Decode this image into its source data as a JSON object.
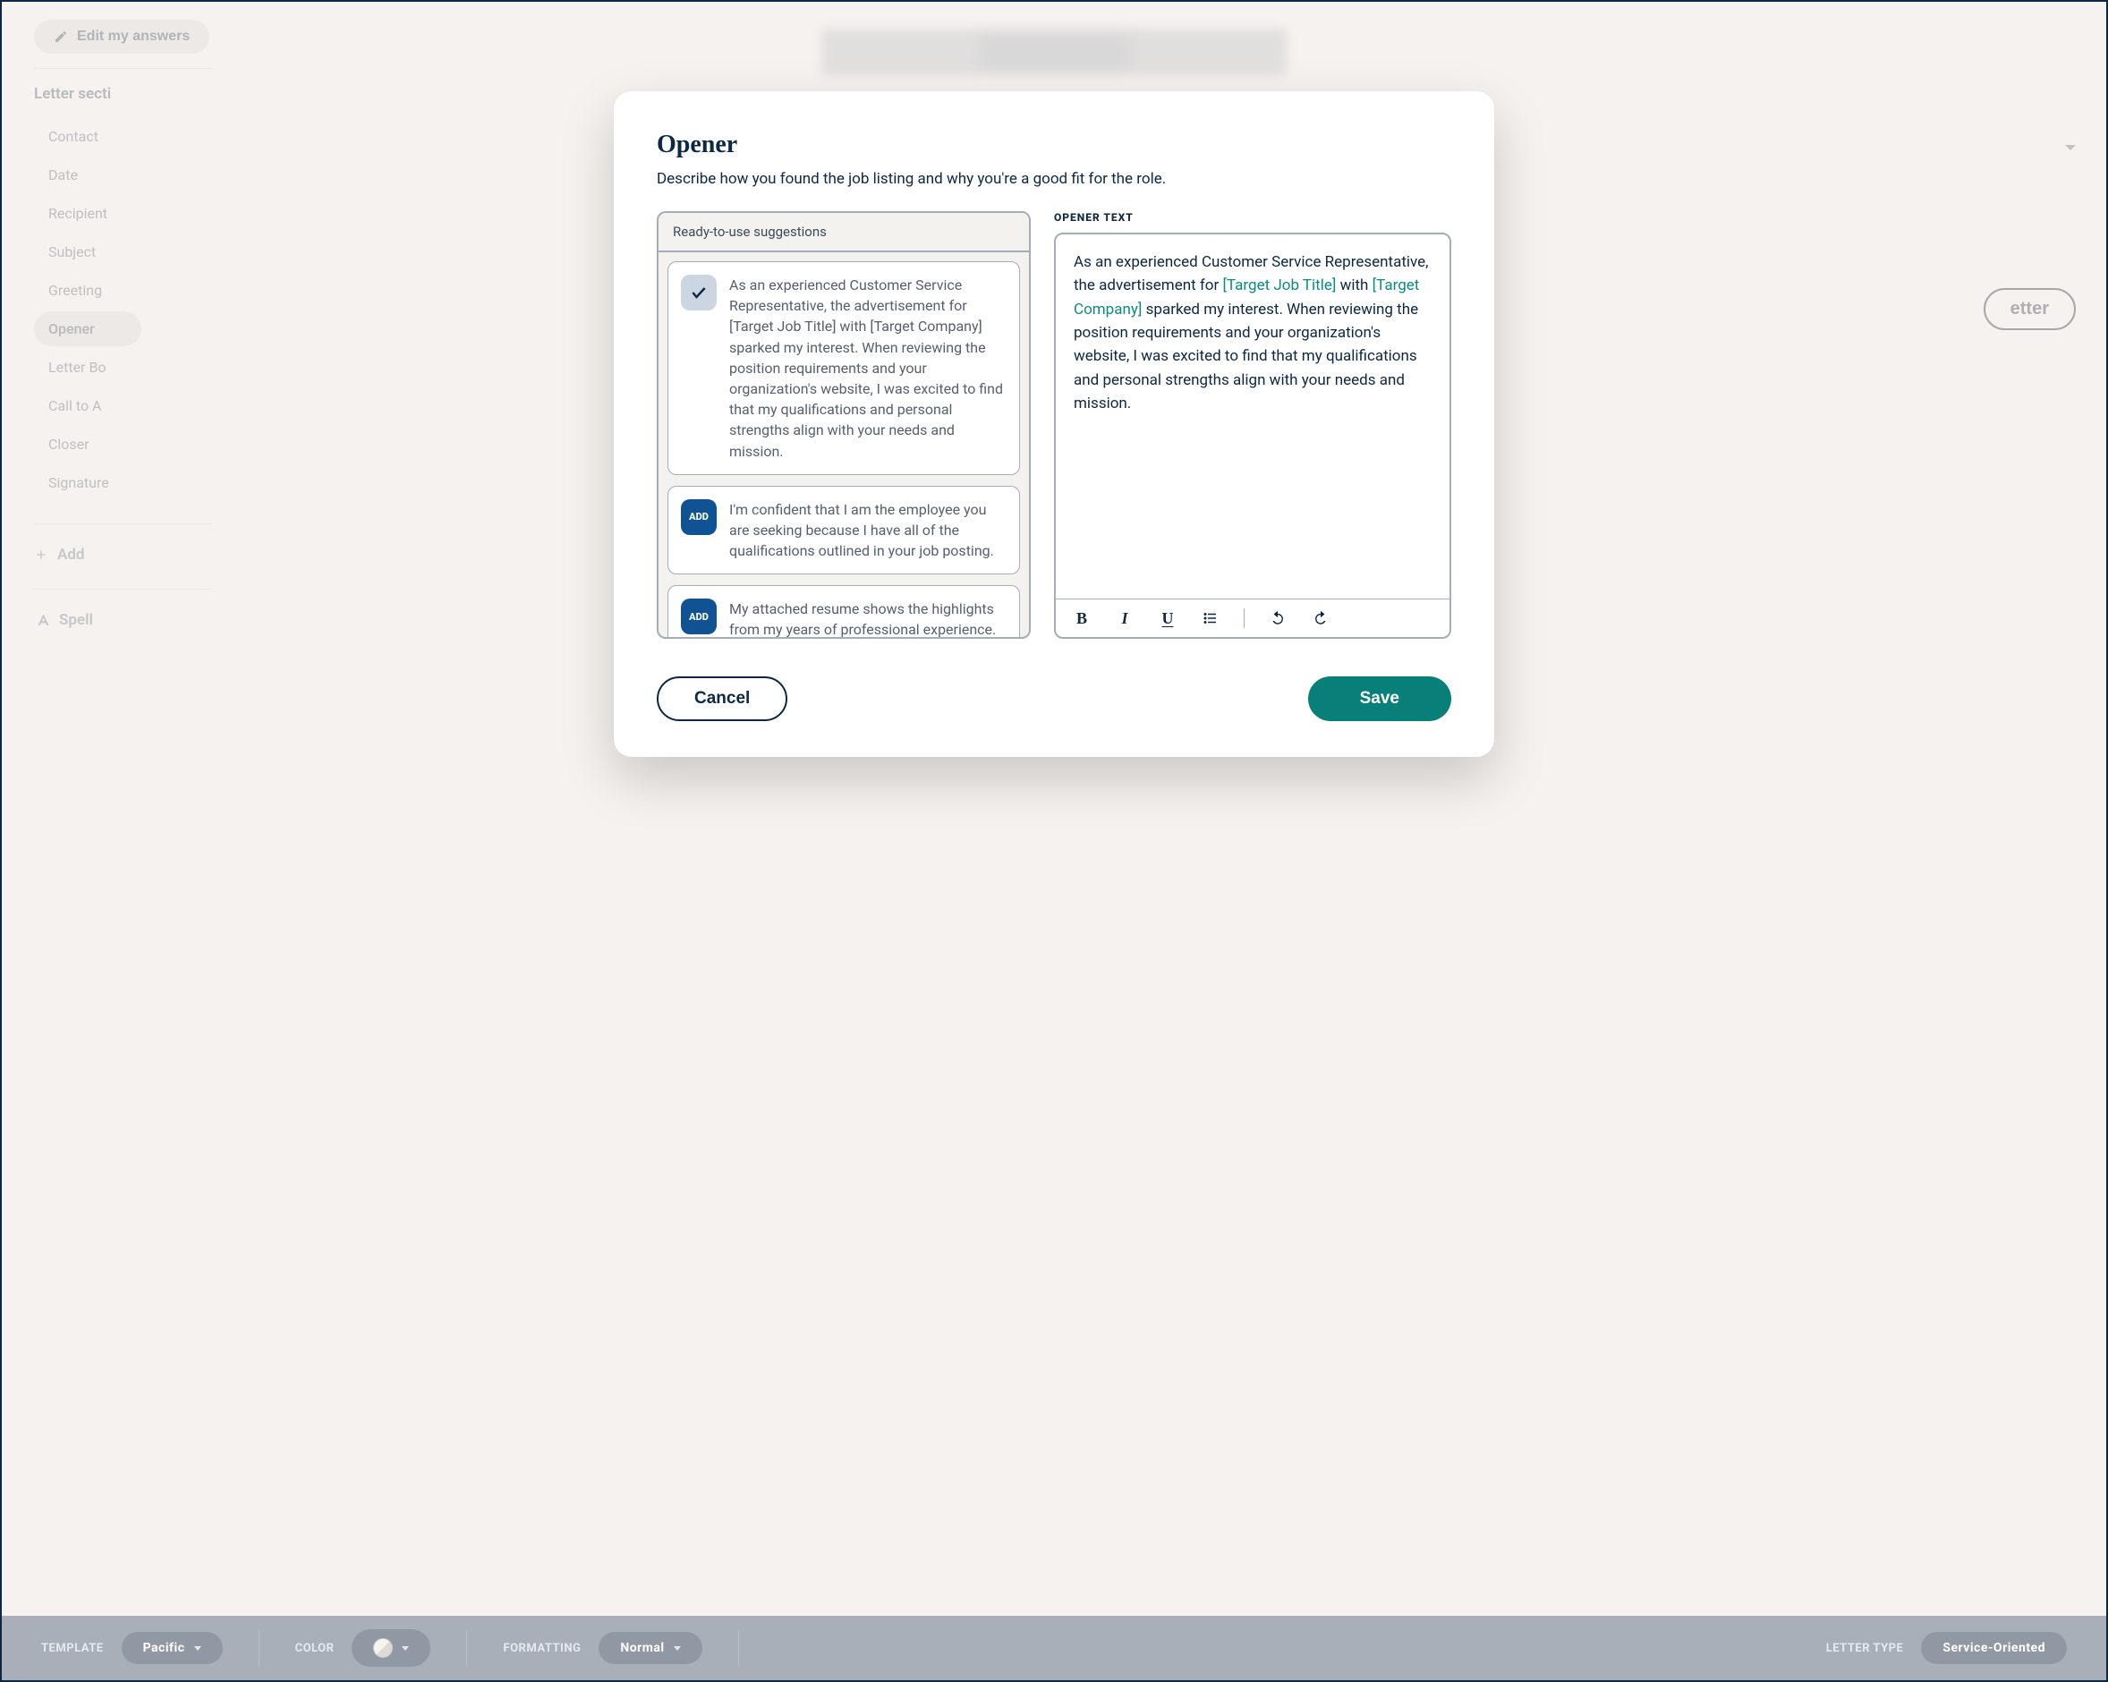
{
  "header": {
    "edit_answers": "Edit my answers"
  },
  "sidebar": {
    "title_truncated": "Letter secti",
    "items": [
      {
        "label": "Contact"
      },
      {
        "label": "Date"
      },
      {
        "label": "Recipient"
      },
      {
        "label": "Subject"
      },
      {
        "label": "Greeting"
      },
      {
        "label": "Opener",
        "active": true
      },
      {
        "label": "Letter Bo"
      },
      {
        "label": "Call to A"
      },
      {
        "label": "Closer"
      },
      {
        "label": "Signature"
      }
    ],
    "add_section_truncated": "Add",
    "spellcheck_truncated": "Spell"
  },
  "preview_button_truncated": "etter",
  "modal": {
    "title": "Opener",
    "subtitle": "Describe how you found the job listing and why you're a good fit for the role.",
    "suggestions_header": "Ready-to-use suggestions",
    "add_label": "ADD",
    "suggestions": [
      {
        "selected": true,
        "text": "As an experienced Customer Service Representative, the advertisement for [Target Job Title] with [Target Company] sparked my interest. When reviewing the position requirements and your organization's website, I was excited to find that my qualifications and personal strengths align with your needs and mission."
      },
      {
        "selected": false,
        "text": "I'm confident that I am the employee you are seeking because I have all of the qualifications outlined in your job posting."
      },
      {
        "selected": false,
        "text": "My attached resume shows the highlights from my years of professional experience."
      }
    ],
    "editor_label": "OPENER TEXT",
    "editor_text_parts": [
      {
        "t": "As an experienced Customer Service Representative, the advertisement for ",
        "ph": false
      },
      {
        "t": "[Target Job Title]",
        "ph": true
      },
      {
        "t": " with ",
        "ph": false
      },
      {
        "t": "[Target Company]",
        "ph": true
      },
      {
        "t": " sparked my interest. When reviewing the position requirements and your organization's website, I was excited to find that my qualifications and personal strengths align with your needs and mission.",
        "ph": false
      }
    ],
    "cancel": "Cancel",
    "save": "Save"
  },
  "bottombar": {
    "template_label": "TEMPLATE",
    "template_value": "Pacific",
    "color_label": "COLOR",
    "formatting_label": "FORMATTING",
    "formatting_value": "Normal",
    "lettertype_label": "LETTER TYPE",
    "lettertype_value": "Service-Oriented"
  }
}
